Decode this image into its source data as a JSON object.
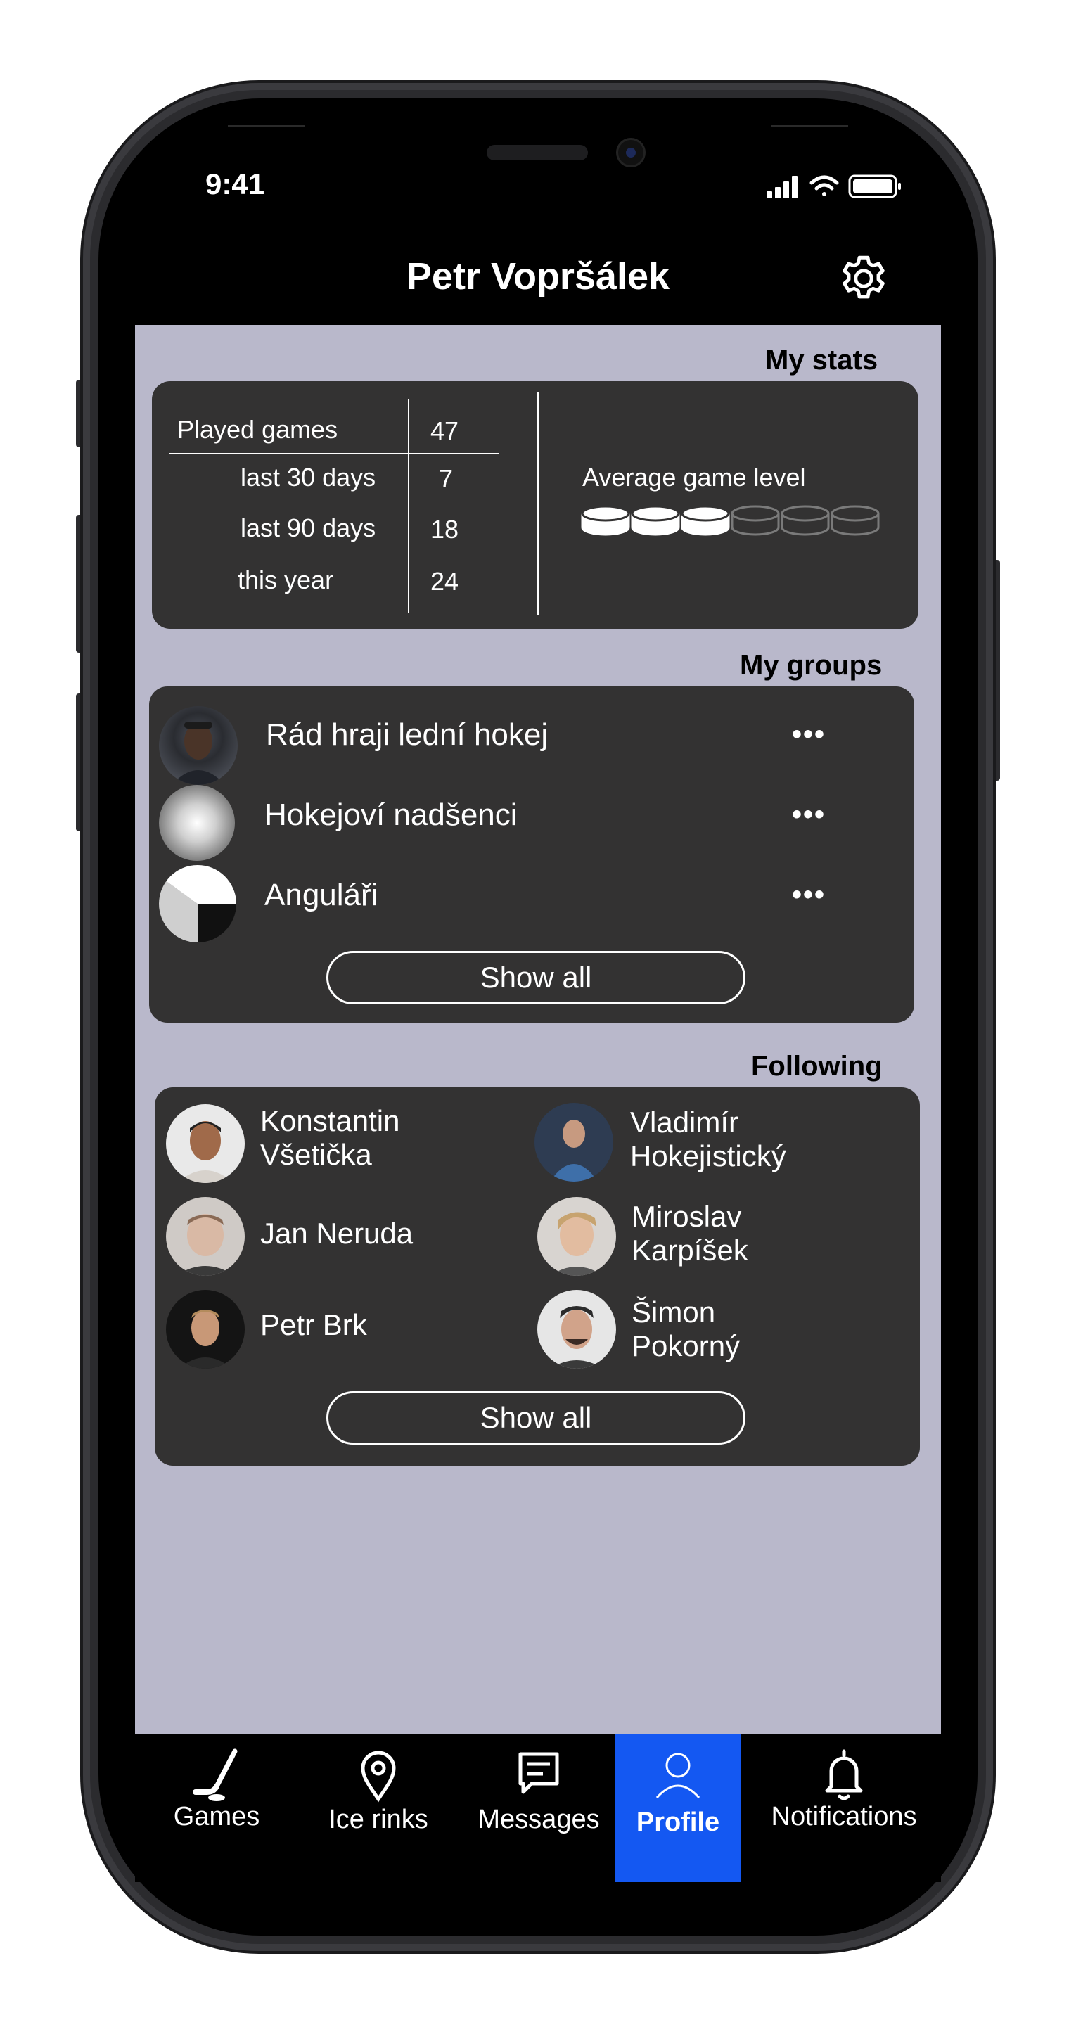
{
  "status_bar": {
    "time": "9:41"
  },
  "header": {
    "title": "Petr Vopršálek",
    "settings_icon": "gear-icon"
  },
  "stats": {
    "section_title": "My stats",
    "rows": [
      {
        "label": "Played games",
        "value": "47"
      },
      {
        "label": "last 30 days",
        "value": "7"
      },
      {
        "label": "last 90 days",
        "value": "18"
      },
      {
        "label": "this year",
        "value": "24"
      }
    ],
    "level_label": "Average game level",
    "level_filled": 3,
    "level_total": 6
  },
  "groups": {
    "section_title": "My groups",
    "items": [
      {
        "name": "Rád hraji lední hokej",
        "more": "•••"
      },
      {
        "name": "Hokejoví nadšenci",
        "more": "•••"
      },
      {
        "name": "Anguláři",
        "more": "•••"
      }
    ],
    "show_all": "Show all"
  },
  "following": {
    "section_title": "Following",
    "people": [
      {
        "line1": "Konstantin",
        "line2": "Všetička"
      },
      {
        "line1": "Vladimír",
        "line2": "Hokejistický"
      },
      {
        "line1": "Jan Neruda",
        "line2": ""
      },
      {
        "line1": "Miroslav",
        "line2": "Karpíšek"
      },
      {
        "line1": "Petr Brk",
        "line2": ""
      },
      {
        "line1": "Šimon",
        "line2": "Pokorný"
      }
    ],
    "show_all": "Show all"
  },
  "nav": {
    "items": [
      {
        "label": "Games",
        "icon": "hockey-stick-icon"
      },
      {
        "label": "Ice rinks",
        "icon": "map-pin-icon"
      },
      {
        "label": "Messages",
        "icon": "message-icon"
      },
      {
        "label": "Profile",
        "icon": "user-icon"
      },
      {
        "label": "Notifications",
        "icon": "bell-icon"
      }
    ],
    "active": "Profile",
    "active_color": "#1458f2"
  }
}
